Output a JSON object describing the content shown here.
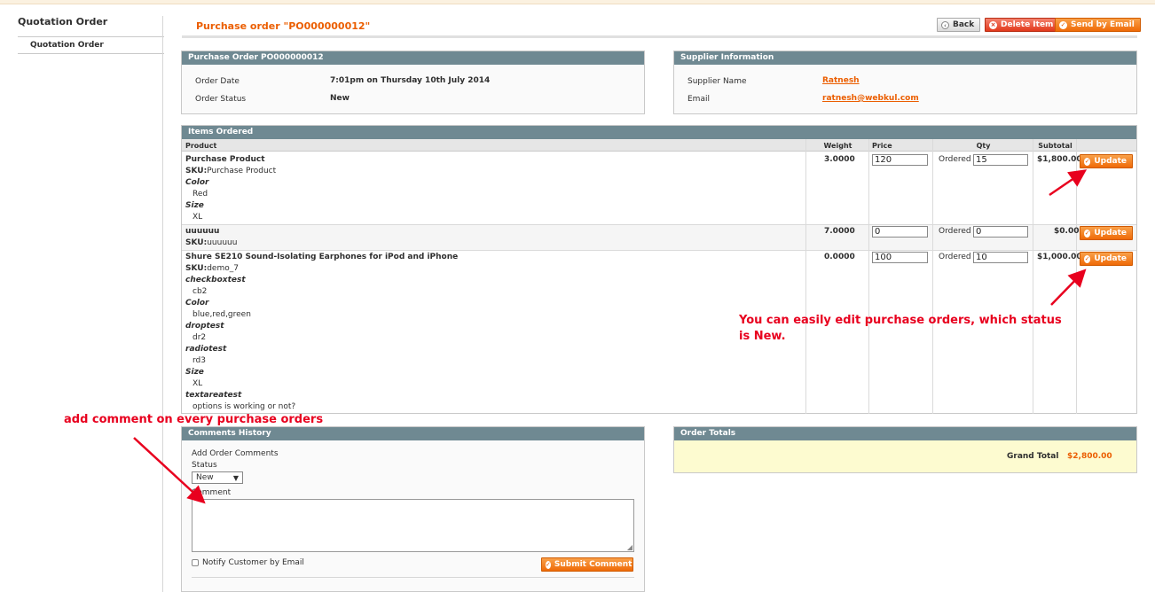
{
  "sidebar": {
    "title": "Quotation Order",
    "items": [
      {
        "label": "Quotation Order"
      }
    ]
  },
  "header": {
    "title": "Purchase order \"PO000000012\"",
    "buttons": {
      "back": "Back",
      "delete": "Delete Item",
      "send": "Send by Email"
    }
  },
  "order_info": {
    "heading": "Purchase Order PO000000012",
    "date_label": "Order Date",
    "date_value": "7:01pm on Thursday 10th July 2014",
    "status_label": "Order Status",
    "status_value": "New"
  },
  "supplier_info": {
    "heading": "Supplier Information",
    "name_label": "Supplier Name",
    "name_value": "Ratnesh",
    "email_label": "Email",
    "email_value": "ratnesh@webkul.com"
  },
  "items": {
    "heading": "Items Ordered",
    "columns": [
      "Product",
      "Weight",
      "Price",
      "Qty",
      "Subtotal"
    ],
    "ordered_label": "Ordered",
    "update_label": "Update",
    "rows": [
      {
        "name": "Purchase Product",
        "sku_label": "SKU:",
        "sku": "Purchase Product",
        "options": [
          {
            "label": "Color",
            "value": "Red"
          },
          {
            "label": "Size",
            "value": "XL"
          }
        ],
        "weight": "3.0000",
        "price": "120",
        "qty": "15",
        "subtotal": "$1,800.00"
      },
      {
        "name": "uuuuuu",
        "sku_label": "SKU:",
        "sku": "uuuuuu",
        "options": [],
        "weight": "7.0000",
        "price": "0",
        "qty": "0",
        "subtotal": "$0.00"
      },
      {
        "name": "Shure SE210 Sound-Isolating Earphones for iPod and iPhone",
        "sku_label": "SKU:",
        "sku": "demo_7",
        "options": [
          {
            "label": "checkboxtest",
            "value": "cb2"
          },
          {
            "label": "Color",
            "value": "blue,red,green"
          },
          {
            "label": "droptest",
            "value": "dr2"
          },
          {
            "label": "radiotest",
            "value": "rd3"
          },
          {
            "label": "Size",
            "value": "XL"
          },
          {
            "label": "textareatest",
            "value": "options is working or not?"
          }
        ],
        "weight": "0.0000",
        "price": "100",
        "qty": "10",
        "subtotal": "$1,000.00"
      }
    ]
  },
  "comments": {
    "heading": "Comments History",
    "add_label": "Add Order Comments",
    "status_label": "Status",
    "status_selected": "New",
    "comment_label": "Comment",
    "notify_label": "Notify Customer by Email",
    "submit_label": "Submit Comment"
  },
  "totals": {
    "heading": "Order Totals",
    "grand_total_label": "Grand Total",
    "grand_total_value": "$2,800.00"
  },
  "annotations": {
    "edit_line1": "You can easily edit purchase orders, which status",
    "edit_line2": "is New.",
    "comment": "add comment on every purchase orders"
  },
  "colors": {
    "accent": "#eb5e00",
    "header_bar": "#6f8992",
    "annotation": "#e8001e",
    "totals_bg": "#fdfbd0"
  }
}
